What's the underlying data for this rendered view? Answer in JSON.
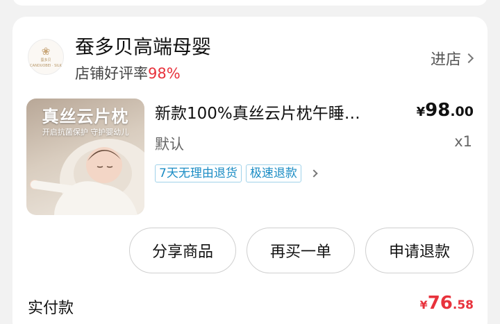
{
  "shop": {
    "logo_text": "蚕多贝",
    "logo_subtext": "CANDUOBEI · SILK",
    "name": "蚕多贝高端母婴",
    "rating_label": "店铺好评率",
    "rating_value": "98%",
    "enter_label": "进店"
  },
  "product": {
    "image_headline": "真丝云片枕",
    "image_subtitle": "开启抗菌保护 守护婴幼儿",
    "title": "新款100%真丝云片枕午睡…",
    "price_symbol": "¥",
    "price_integer": "98",
    "price_decimal": ".00",
    "variant": "默认",
    "quantity": "x1",
    "tags": [
      "7天无理由退货",
      "极速退款"
    ]
  },
  "actions": {
    "share_label": "分享商品",
    "rebuy_label": "再买一单",
    "refund_label": "申请退款"
  },
  "payment": {
    "label": "实付款",
    "symbol": "¥",
    "integer": "76",
    "decimal": ".58"
  },
  "colors": {
    "accent_red": "#e8323c",
    "tag_blue": "#1a8cc4",
    "tag_border": "#9fd2ea"
  }
}
